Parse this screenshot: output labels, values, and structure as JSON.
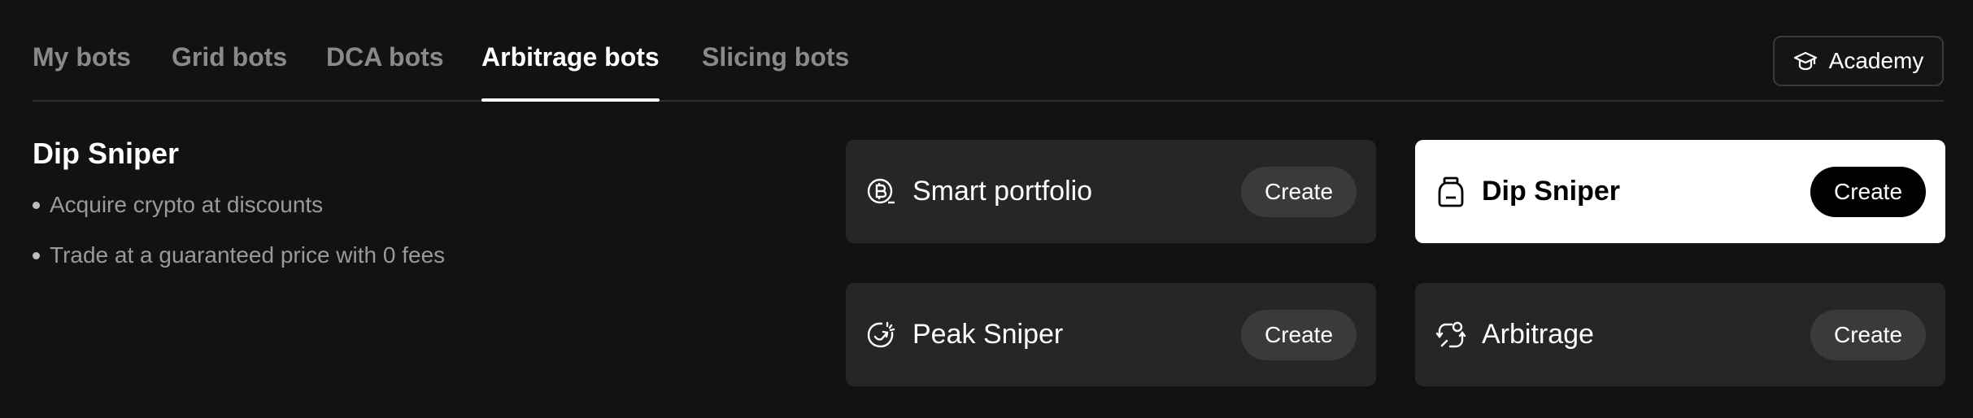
{
  "tabs": [
    {
      "label": "My bots",
      "active": false
    },
    {
      "label": "Grid bots",
      "active": false
    },
    {
      "label": "DCA bots",
      "active": false
    },
    {
      "label": "Arbitrage bots",
      "active": true
    },
    {
      "label": "Slicing bots",
      "active": false
    }
  ],
  "academy": {
    "label": "Academy",
    "icon": "graduation-cap-icon"
  },
  "description": {
    "title": "Dip Sniper",
    "points": [
      "Acquire crypto at discounts",
      "Trade at a guaranteed price with 0 fees"
    ]
  },
  "cards": [
    {
      "label": "Smart portfolio",
      "button": "Create",
      "icon": "bitcoin-coin-icon",
      "selected": false
    },
    {
      "label": "Dip Sniper",
      "button": "Create",
      "icon": "jar-icon",
      "selected": true
    },
    {
      "label": "Peak Sniper",
      "button": "Create",
      "icon": "target-arrow-icon",
      "selected": false
    },
    {
      "label": "Arbitrage",
      "button": "Create",
      "icon": "arbitrage-icon",
      "selected": false
    }
  ],
  "colors": {
    "background": "#121212",
    "card": "#262626",
    "card_selected": "#ffffff",
    "muted_text": "#8a8a8a"
  }
}
